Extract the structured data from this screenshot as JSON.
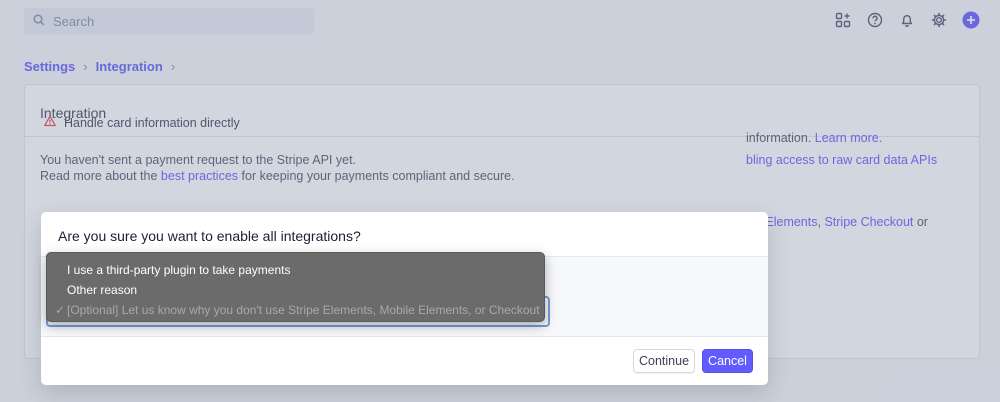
{
  "search": {
    "placeholder": "Search"
  },
  "breadcrumb": {
    "items": [
      "Settings",
      "Integration"
    ]
  },
  "card": {
    "title": "Integration",
    "line1": "You haven't sent a payment request to the Stripe API yet.",
    "line2_pre": "Read more about the ",
    "line2_link": "best practices",
    "line2_post": " for keeping your payments compliant and secure.",
    "warning_label": "Handle card information directly",
    "right1_pre": "information. ",
    "right1_link": "Learn more.",
    "right2": "bling access to raw card data APIs",
    "right3_link1": "pe Elements",
    "right3_sep": ", ",
    "right3_link2": "Stripe Checkout",
    "right3_post": " or"
  },
  "modal": {
    "title": "Are you sure you want to enable all integrations?",
    "continue_label": "Continue",
    "cancel_label": "Cancel"
  },
  "dropdown": {
    "options": [
      {
        "label": "I use a third-party plugin to take payments"
      },
      {
        "label": "Other reason"
      },
      {
        "label": "[Optional] Let us know why you don't use Stripe Elements, Mobile Elements, or Checkout",
        "check": "✓"
      }
    ]
  },
  "colors": {
    "accent": "#635bff",
    "warning": "#e5424d"
  },
  "icons": [
    "search-icon",
    "apps-icon",
    "help-icon",
    "bell-icon",
    "gear-icon",
    "plus-circle-icon",
    "warning-icon",
    "chevron-right-icon"
  ]
}
